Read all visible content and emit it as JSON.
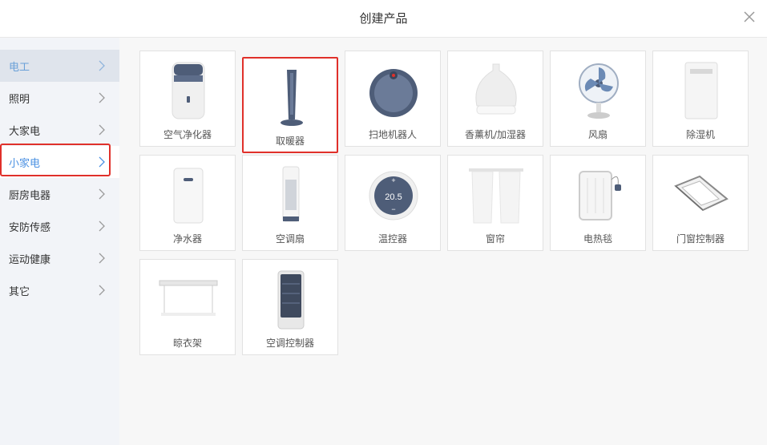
{
  "dialog": {
    "title": "创建产品"
  },
  "categories": [
    {
      "label": "电工"
    },
    {
      "label": "照明"
    },
    {
      "label": "大家电"
    },
    {
      "label": "小家电"
    },
    {
      "label": "厨房电器"
    },
    {
      "label": "安防传感"
    },
    {
      "label": "运动健康"
    },
    {
      "label": "其它"
    }
  ],
  "products": [
    {
      "name": "空气净化器",
      "icon": "air-purifier-icon"
    },
    {
      "name": "取暖器",
      "icon": "heater-icon"
    },
    {
      "name": "扫地机器人",
      "icon": "robot-vacuum-icon"
    },
    {
      "name": "香薰机/加湿器",
      "icon": "humidifier-icon"
    },
    {
      "name": "风扇",
      "icon": "fan-icon"
    },
    {
      "name": "除湿机",
      "icon": "dehumidifier-icon"
    },
    {
      "name": "净水器",
      "icon": "water-purifier-icon"
    },
    {
      "name": "空调扇",
      "icon": "air-cooler-icon"
    },
    {
      "name": "温控器",
      "icon": "thermostat-icon",
      "display_value": "20.5",
      "plus": "+",
      "minus": "−"
    },
    {
      "name": "窗帘",
      "icon": "curtain-icon"
    },
    {
      "name": "电热毯",
      "icon": "electric-blanket-icon"
    },
    {
      "name": "门窗控制器",
      "icon": "window-controller-icon"
    },
    {
      "name": "晾衣架",
      "icon": "clothes-rack-icon"
    },
    {
      "name": "空调控制器",
      "icon": "ac-controller-icon"
    }
  ],
  "colors": {
    "accent": "#4a90e2",
    "highlight": "#e0302a",
    "device_dark": "#4e5d78"
  }
}
